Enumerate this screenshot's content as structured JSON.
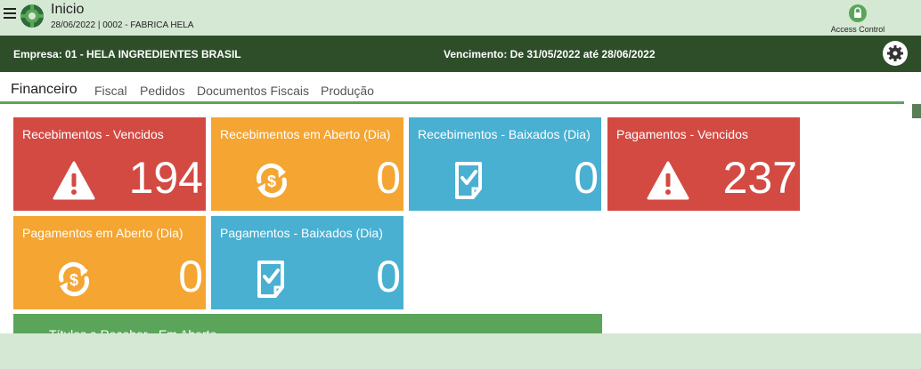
{
  "app": {
    "title": "Inicio",
    "subtitle": "28/06/2022 | 0002 - FABRICA HELA",
    "access_label": "Access Control",
    "brand_color": "#2e4e2a",
    "icons": [
      "menu-icon",
      "gear-logo-icon",
      "lock-icon",
      "settings-icon"
    ]
  },
  "header": {
    "empresa": "Empresa: 01 - HELA INGREDIENTES BRASIL",
    "vencimento": "Vencimento: De 31/05/2022 até 28/06/2022"
  },
  "tabs": [
    {
      "label": "Financeiro",
      "active": true
    },
    {
      "label": "Fiscal"
    },
    {
      "label": "Pedidos"
    },
    {
      "label": "Documentos Fiscais"
    },
    {
      "label": "Produção"
    }
  ],
  "tiles": [
    {
      "title": "Recebimentos - Vencidos",
      "value": "194",
      "color": "#d34a43",
      "icon": "warning-icon"
    },
    {
      "title": "Recebimentos em Aberto (Dia)",
      "value": "0",
      "color": "#f4a532",
      "icon": "money-cycle-icon"
    },
    {
      "title": "Recebimentos - Baixados (Dia)",
      "value": "0",
      "color": "#49b0d2",
      "icon": "checked-document-icon"
    },
    {
      "title": "Pagamentos - Vencidos",
      "value": "237",
      "color": "#d34a43",
      "icon": "warning-icon"
    },
    {
      "title": "Pagamentos em Aberto (Dia)",
      "value": "0",
      "color": "#f4a532",
      "icon": "money-cycle-icon"
    },
    {
      "title": "Pagamentos - Baixados (Dia)",
      "value": "0",
      "color": "#49b0d2",
      "icon": "checked-document-icon"
    }
  ],
  "panel": {
    "title": "Títulos a Receber - Em Aberto"
  }
}
